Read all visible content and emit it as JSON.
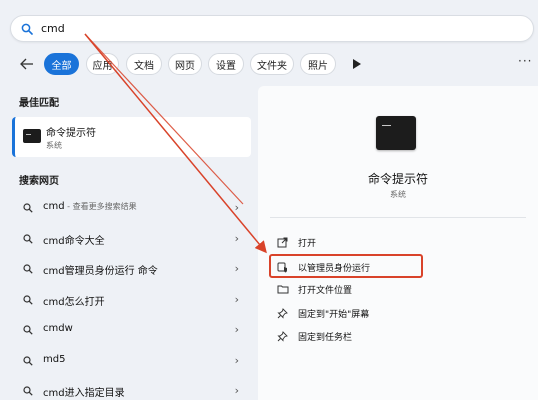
{
  "search": {
    "value": "cmd"
  },
  "filters": [
    {
      "label": "全部",
      "active": true
    },
    {
      "label": "应用"
    },
    {
      "label": "文档"
    },
    {
      "label": "网页"
    },
    {
      "label": "设置"
    },
    {
      "label": "文件夹"
    },
    {
      "label": "照片"
    }
  ],
  "sections": {
    "best_match": "最佳匹配",
    "web": "搜索网页"
  },
  "best_match": {
    "name": "命令提示符",
    "type": "系统"
  },
  "web_results": [
    {
      "text": "cmd",
      "extra": " - 查看更多搜索结果"
    },
    {
      "text": "cmd命令大全",
      "extra": ""
    },
    {
      "text": "cmd管理员身份运行 命令",
      "extra": ""
    },
    {
      "text": "cmd怎么打开",
      "extra": ""
    },
    {
      "text": "cmdw",
      "extra": ""
    },
    {
      "text": "md5",
      "extra": ""
    },
    {
      "text": "cmd进入指定目录",
      "extra": ""
    }
  ],
  "right_pane": {
    "title": "命令提示符",
    "subtitle": "系统",
    "actions": [
      {
        "label": "打开",
        "icon": "open-icon"
      },
      {
        "label": "以管理员身份运行",
        "icon": "shield-icon"
      },
      {
        "label": "打开文件位置",
        "icon": "folder-icon"
      },
      {
        "label": "固定到\"开始\"屏幕",
        "icon": "pin-icon"
      },
      {
        "label": "固定到任务栏",
        "icon": "pin-icon"
      }
    ]
  },
  "colors": {
    "accent": "#1a73d9",
    "annotation": "#d9432a"
  }
}
